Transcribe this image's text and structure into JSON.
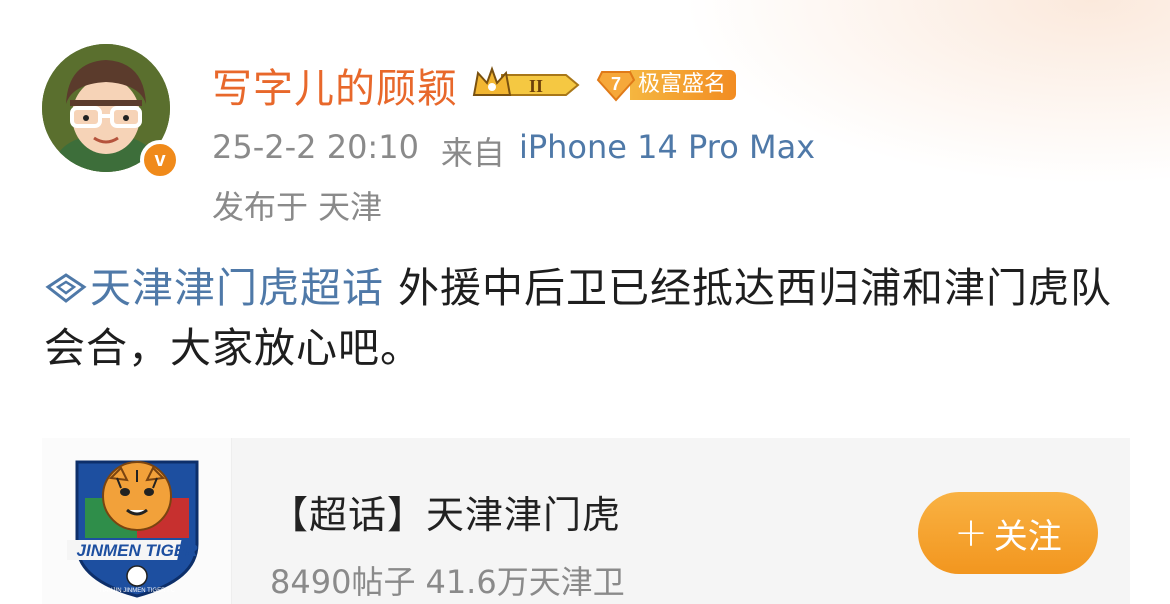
{
  "header": {
    "username": "写字儿的顾颖",
    "level_badge_text": "II",
    "fame_level": "7",
    "fame_label": "极富盛名",
    "verified_mark": "v",
    "timestamp": "25-2-2 20:10",
    "source_prefix": "来自",
    "device": "iPhone 14 Pro Max",
    "location": "发布于 天津"
  },
  "post": {
    "topic_link": "天津津门虎超话",
    "text": " 外援中后卫已经抵达西归浦和津门虎队会合，大家放心吧。"
  },
  "card": {
    "title": "【超话】天津津门虎",
    "posts_count": "8490",
    "posts_label": "帖子",
    "followers_count": "41.6",
    "followers_label": "万天津卫",
    "follow_plus": "+",
    "follow_label": "关注",
    "logo_text": "JINMEN TIGER",
    "logo_subtext": "TIANJIN JINMEN TIGER FC"
  },
  "colors": {
    "username": "#e8682b",
    "link": "#4f79a8",
    "follow_button": "#f2961f",
    "meta_text": "#8a8a8a"
  },
  "icons": {
    "topic": "diamond-topic-icon",
    "crown": "crown-icon",
    "verified": "verified-v-icon"
  }
}
